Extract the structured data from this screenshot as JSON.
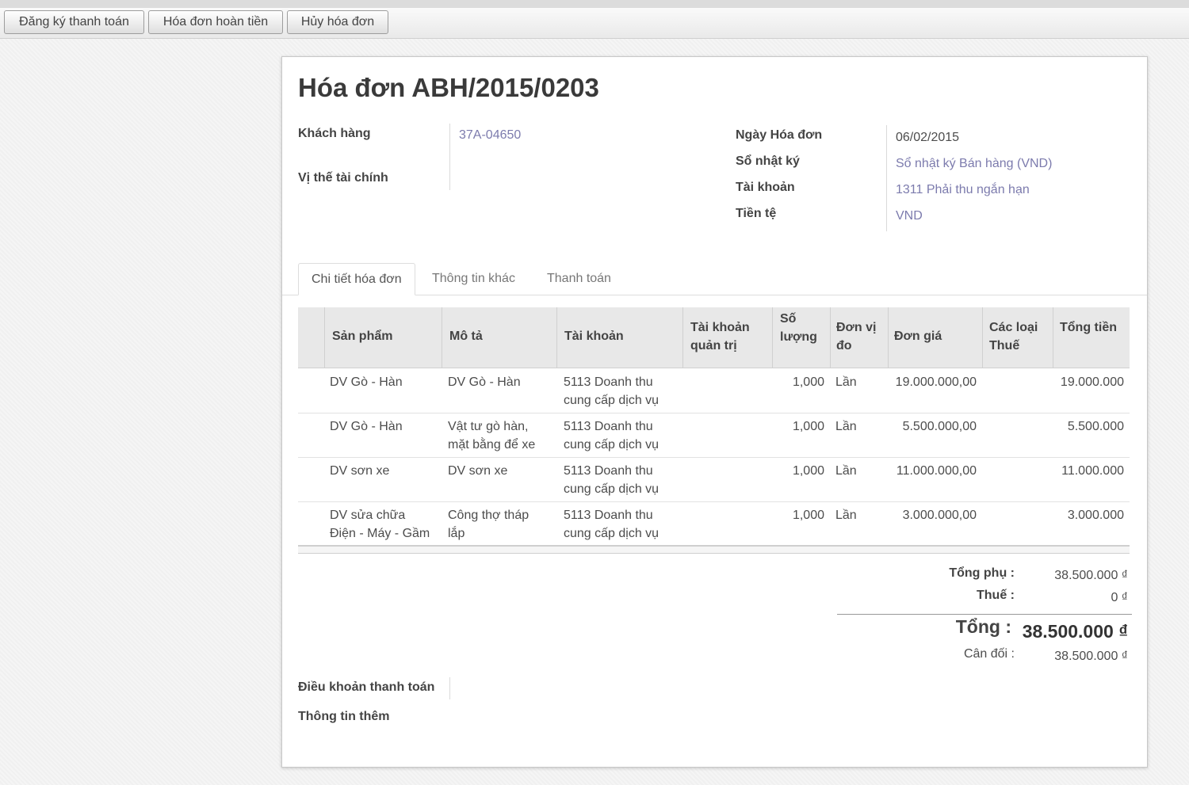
{
  "toolbar": {
    "register_payment": "Đăng ký thanh toán",
    "refund_invoice": "Hóa đơn hoàn tiền",
    "cancel_invoice": "Hủy hóa đơn"
  },
  "invoice": {
    "title": "Hóa đơn ABH/2015/0203",
    "customer_label": "Khách hàng",
    "customer_value": "37A-04650",
    "fiscal_position_label": "Vị thế tài chính",
    "date_label": "Ngày Hóa đơn",
    "date_value": "06/02/2015",
    "journal_label": "Sổ nhật ký",
    "journal_value": "Sổ nhật ký Bán hàng (VND)",
    "account_label": "Tài khoản",
    "account_value": "1311 Phải thu ngắn hạn",
    "currency_label": "Tiền tệ",
    "currency_value": "VND"
  },
  "tabs": [
    "Chi tiết hóa đơn",
    "Thông tin khác",
    "Thanh toán"
  ],
  "table": {
    "headers": [
      "Sản phẩm",
      "Mô tả",
      "Tài khoản",
      "Tài khoản\nquản trị",
      "Số\nlượng",
      "Đơn vị\nđo",
      "Đơn giá",
      "Các loại\nThuế",
      "Tổng tiền"
    ],
    "rows": [
      {
        "product": "DV Gò - Hàn",
        "description": "DV Gò - Hàn",
        "account": "5113 Doanh thu\ncung cấp dịch vụ",
        "analytic": "",
        "qty": "1,000",
        "uom": "Lần",
        "price": "19.000.000,00",
        "taxes": "",
        "total": "19.000.000"
      },
      {
        "product": "DV Gò - Hàn",
        "description": "Vật tư gò hàn,\nmặt bằng để xe",
        "account": "5113 Doanh thu\ncung cấp dịch vụ",
        "analytic": "",
        "qty": "1,000",
        "uom": "Lần",
        "price": "5.500.000,00",
        "taxes": "",
        "total": "5.500.000"
      },
      {
        "product": "DV sơn xe",
        "description": "DV sơn xe",
        "account": "5113 Doanh thu\ncung cấp dịch vụ",
        "analytic": "",
        "qty": "1,000",
        "uom": "Lần",
        "price": "11.000.000,00",
        "taxes": "",
        "total": "11.000.000"
      },
      {
        "product": "DV sửa chữa\nĐiện - Máy - Gầm",
        "description": "Công thợ tháp\nlắp",
        "account": "5113 Doanh thu\ncung cấp dịch vụ",
        "analytic": "",
        "qty": "1,000",
        "uom": "Lần",
        "price": "3.000.000,00",
        "taxes": "",
        "total": "3.000.000"
      }
    ]
  },
  "totals": {
    "subtotal_label": "Tổng phụ :",
    "subtotal_value": "38.500.000 ₫",
    "tax_label": "Thuế :",
    "tax_value": "0 ₫",
    "total_label": "Tổng :",
    "total_value": "38.500.000 ₫",
    "balance_label": "Cân đối :",
    "balance_value": "38.500.000 ₫"
  },
  "footer": {
    "payment_terms_label": "Điều khoản thanh toán",
    "more_info_label": "Thông tin thêm"
  },
  "colors": {
    "link": "#7c7bad",
    "header_bg": "#e8e8e8"
  }
}
